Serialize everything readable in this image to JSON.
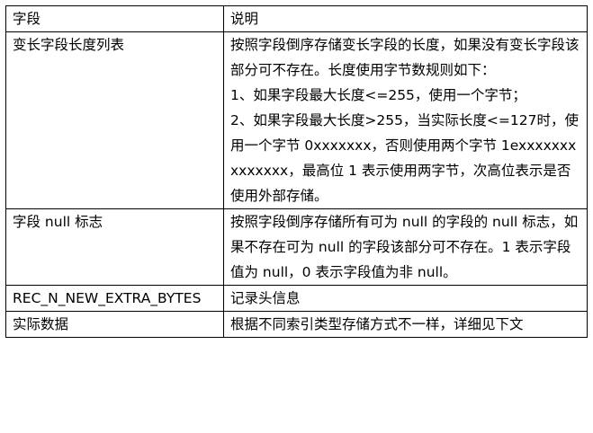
{
  "table": {
    "header": {
      "field": "字段",
      "description": "说明"
    },
    "rows": [
      {
        "field": "变长字段长度列表",
        "lines": [
          "按照字段倒序存储变长字段的长度，如果没有变长字段该部分可不存在。长度使用字节数规则如下：",
          "1、如果字段最大长度<=255，使用一个字节；",
          "2、如果字段最大长度>255，当实际长度<=127时，使用一个字节 0xxxxxxx，否则使用两个字节 1exxxxxxxxxxxxxx，最高位 1 表示使用两字节，次高位表示是否使用外部存储。"
        ]
      },
      {
        "field": "字段 null 标志",
        "lines": [
          "按照字段倒序存储所有可为 null 的字段的 null 标志，如果不存在可为 null 的字段该部分可不存在。1 表示字段值为 null，0 表示字段值为非 null。"
        ]
      },
      {
        "field": "REC_N_NEW_EXTRA_BYTES",
        "lines": [
          "记录头信息"
        ]
      },
      {
        "field": "实际数据",
        "lines": [
          "根据不同索引类型存储方式不一样，详细见下文"
        ]
      }
    ]
  }
}
